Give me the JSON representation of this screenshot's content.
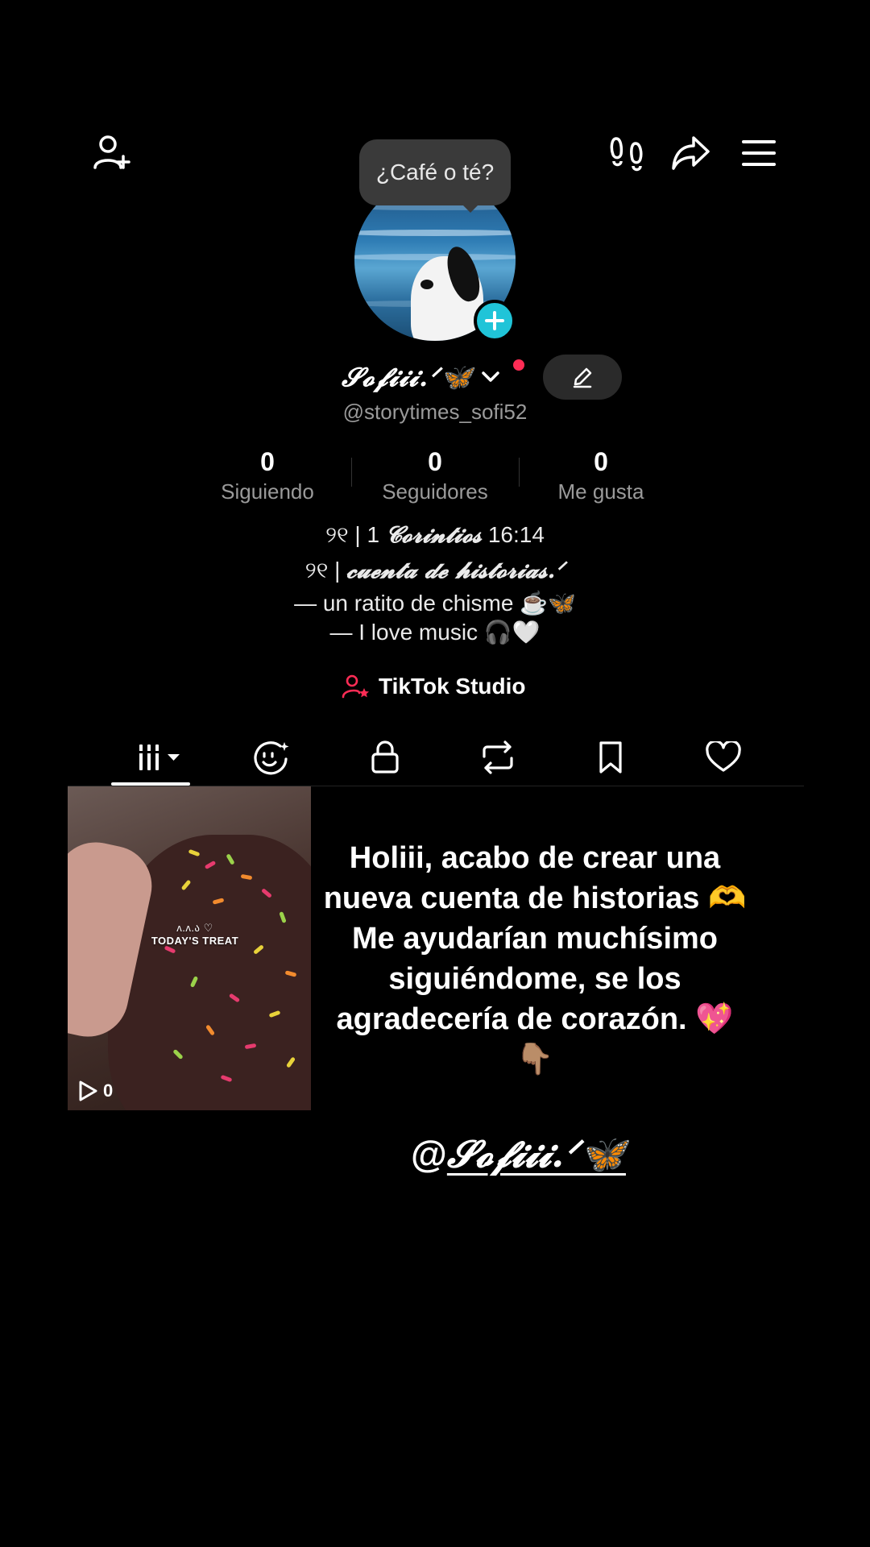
{
  "header": {
    "add_friend_icon": "person-add-icon",
    "footprints_icon": "footprints-icon",
    "share_icon": "share-icon",
    "menu_icon": "hamburger-menu-icon"
  },
  "tooltip": {
    "text": "¿Café o té?"
  },
  "profile": {
    "display_name": "𝓢𝓸𝓯𝓲𝓲𝓲.ᐟ🦋",
    "handle": "@storytimes_sofi52",
    "add_icon": "plus-icon",
    "edit_icon": "pencil-icon"
  },
  "stats": [
    {
      "value": "0",
      "label": "Siguiendo"
    },
    {
      "value": "0",
      "label": "Seguidores"
    },
    {
      "value": "0",
      "label": "Me gusta"
    }
  ],
  "bio": {
    "line1_prefix": "୨୧ | 1 ",
    "line1_fancy": "𝓒𝓸𝓻𝓲𝓷𝓽𝓲𝓸𝓼",
    "line1_suffix": " 16:14",
    "line2_prefix": "୨୧ | ",
    "line2_fancy": "𝓬𝓾𝓮𝓷𝓽𝓪 𝓭𝓮 𝓱𝓲𝓼𝓽𝓸𝓻𝓲𝓪𝓼.ᐟ",
    "line3": "— un ratito de chisme ☕️🦋",
    "line4": "— I love music 🎧🤍"
  },
  "studio": {
    "label": "TikTok Studio",
    "icon": "person-star-icon"
  },
  "tabs": [
    {
      "name": "videos",
      "icon": "grid-bars-icon",
      "active": true
    },
    {
      "name": "ai-self",
      "icon": "face-sparkle-icon"
    },
    {
      "name": "private",
      "icon": "lock-icon"
    },
    {
      "name": "reposts",
      "icon": "repost-icon"
    },
    {
      "name": "favorites",
      "icon": "bookmark-icon"
    },
    {
      "name": "liked",
      "icon": "heart-icon"
    }
  ],
  "video": {
    "caption": "TODAY'S TREAT",
    "caption_top": "ᴧ.ᴧ.ა ♡",
    "views": "0",
    "play_icon": "play-outline-icon"
  },
  "overlay": {
    "message_lines": [
      "Holiii, acabo de crear una",
      "nueva cuenta de historias 🫶",
      "Me ayudarían muchísimo",
      "siguiéndome, se los",
      "agradecería de corazón. 💖",
      "👇🏽"
    ],
    "mention_prefix": "@",
    "mention_name": "𝓢𝓸𝓯𝓲𝓲𝓲.ᐟ🦋"
  },
  "colors": {
    "accent_cyan": "#20c4d8",
    "accent_red": "#fe2c55",
    "background": "#000000",
    "muted_text": "#9a9a9a"
  }
}
